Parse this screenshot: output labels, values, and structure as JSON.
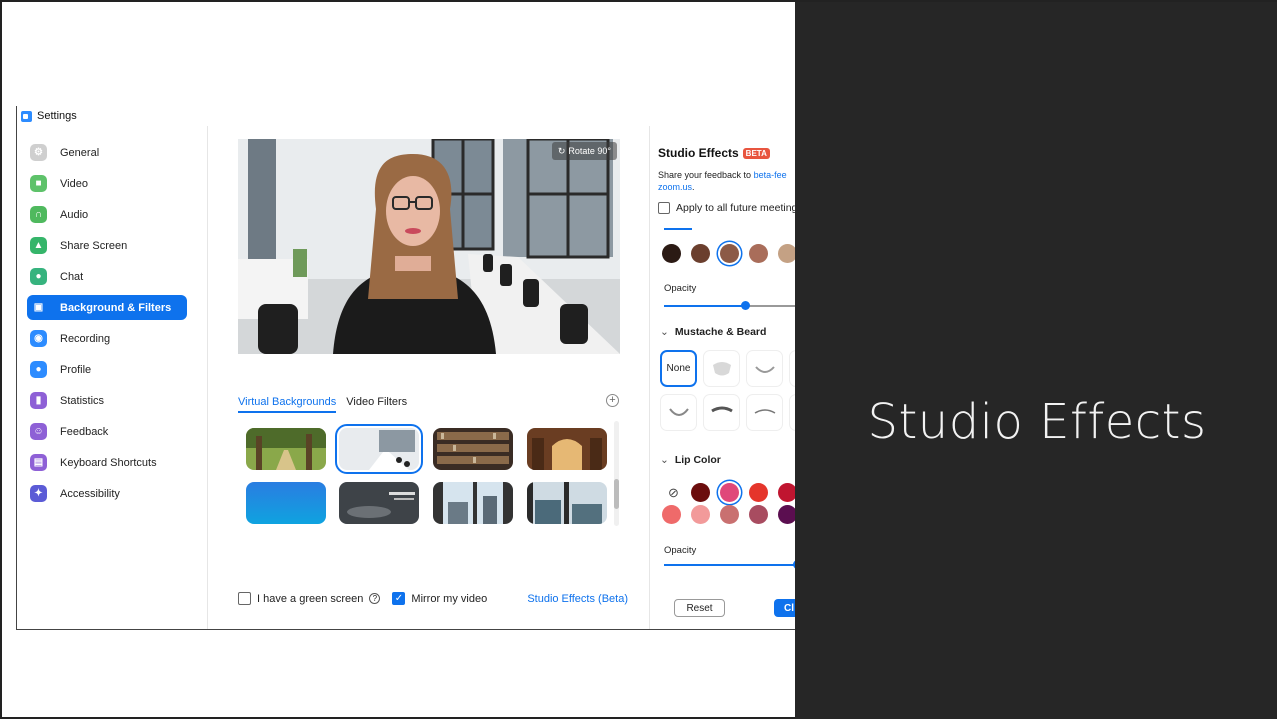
{
  "window": {
    "title": "Settings"
  },
  "sidebar": {
    "items": [
      {
        "label": "General",
        "icon": "gear-icon",
        "color": "#cfcfcf"
      },
      {
        "label": "Video",
        "icon": "video-camera-icon",
        "color": "#5ec26a"
      },
      {
        "label": "Audio",
        "icon": "headphones-icon",
        "color": "#4fb95e"
      },
      {
        "label": "Share Screen",
        "icon": "share-screen-icon",
        "color": "#35b56a"
      },
      {
        "label": "Chat",
        "icon": "chat-bubble-icon",
        "color": "#36b37e"
      },
      {
        "label": "Background & Filters",
        "icon": "background-icon",
        "color": "#0e72ed",
        "active": true
      },
      {
        "label": "Recording",
        "icon": "record-icon",
        "color": "#2d8cff"
      },
      {
        "label": "Profile",
        "icon": "person-icon",
        "color": "#2d8cff"
      },
      {
        "label": "Statistics",
        "icon": "bar-chart-icon",
        "color": "#8e60d6"
      },
      {
        "label": "Feedback",
        "icon": "smile-icon",
        "color": "#8e60d6"
      },
      {
        "label": "Keyboard Shortcuts",
        "icon": "keyboard-icon",
        "color": "#8e60d6"
      },
      {
        "label": "Accessibility",
        "icon": "accessibility-icon",
        "color": "#5b5bd6"
      }
    ]
  },
  "preview": {
    "rotate_label": "Rotate 90°"
  },
  "tabs": [
    {
      "label": "Virtual Backgrounds",
      "active": true
    },
    {
      "label": "Video Filters",
      "active": false
    }
  ],
  "add_button": "+",
  "bottom": {
    "green_screen_label": "I have a green screen",
    "green_screen_checked": false,
    "mirror_label": "Mirror my video",
    "mirror_checked": true,
    "studio_effects_link": "Studio Effects (Beta)"
  },
  "effects": {
    "title": "Studio Effects",
    "badge": "BETA",
    "feedback_prefix": "Share your feedback to",
    "feedback_link_1": "beta-fee",
    "feedback_link_2": "zoom.us",
    "feedback_suffix": ".",
    "apply_label": "Apply to all future meeting",
    "brow_colors": [
      "#2b1a14",
      "#6b3f2e",
      "#8c5a46",
      "#a96d5a",
      "#c4a184"
    ],
    "brow_opacity_label": "Opacity",
    "brow_opacity": 0.58,
    "mustache_title": "Mustache & Beard",
    "none_label": "None",
    "lip_title": "Lip Color",
    "lip_colors_row1": [
      "#6b0d0d",
      "#e0487a",
      "#e5352b",
      "#c01530"
    ],
    "lip_colors_row2": [
      "#ef6a6a",
      "#f29a9a",
      "#c97070",
      "#a84c60",
      "#5b0e50"
    ],
    "lip_opacity_label": "Opacity",
    "lip_opacity": 0.95,
    "reset_label": "Reset",
    "close_label": "Cl"
  },
  "slide": {
    "title": "Studio Effects"
  }
}
